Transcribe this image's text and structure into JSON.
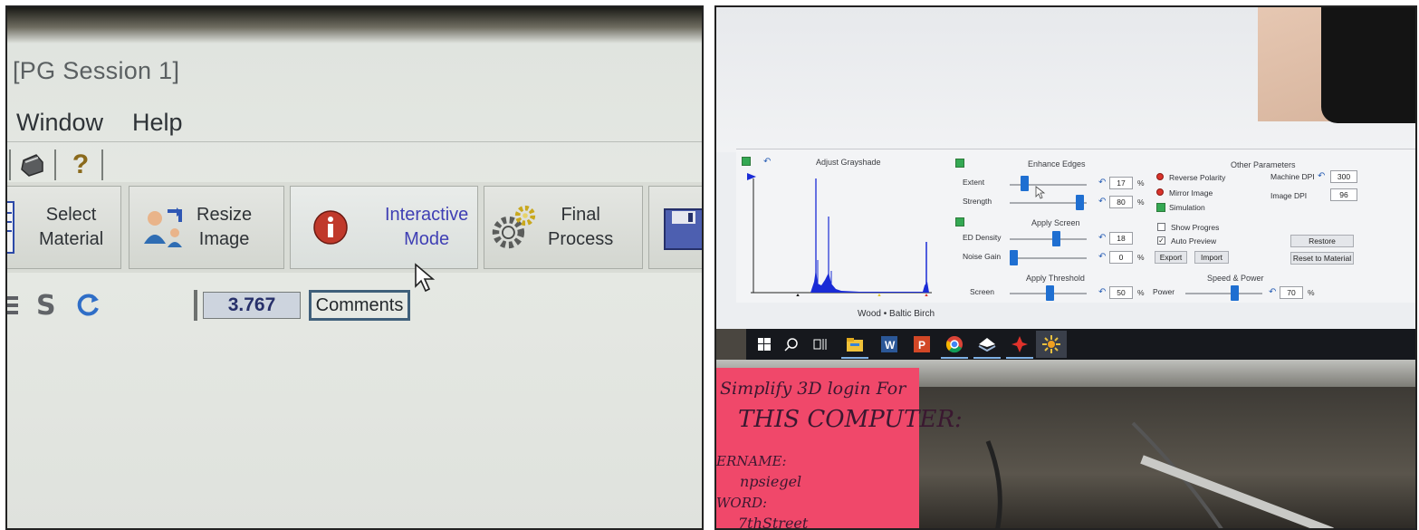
{
  "left": {
    "window_title": "[PG Session 1]",
    "menu": [
      "Window",
      "Help"
    ],
    "toolbar_icons": [
      "printer-icon",
      "help-question-icon"
    ],
    "help_glyph": "?",
    "buttons": [
      {
        "label_line1": "Select",
        "label_line2": "Material",
        "icon": "material-list-icon"
      },
      {
        "label_line1": "Resize",
        "label_line2": "Image",
        "icon": "resize-people-icon"
      },
      {
        "label_line1": "Interactive",
        "label_line2": "Mode",
        "icon": "info-icon",
        "active": true
      },
      {
        "label_line1": "Final",
        "label_line2": "Process",
        "icon": "gears-icon"
      },
      {
        "icon": "floppy-save-icon"
      }
    ],
    "status_value": "3.767",
    "comments_label": "Comments",
    "strip_icon_glyph": "S"
  },
  "right": {
    "grayshade": {
      "title": "Adjust Grayshade",
      "material_name": "Wood",
      "material_sep": "•",
      "material_type": "Baltic Birch"
    },
    "enhance_edges": {
      "title": "Enhance Edges",
      "extent_label": "Extent",
      "extent_value": "17",
      "extent_level": 0.17,
      "strength_label": "Strength",
      "strength_value": "80",
      "strength_level": 0.8,
      "unit": "%"
    },
    "apply_screen": {
      "title": "Apply Screen",
      "ed_density_label": "ED Density",
      "ed_density_value": "18",
      "ed_density_level": 0.5,
      "noise_gain_label": "Noise Gain",
      "noise_gain_value": "0",
      "noise_gain_level": 0.0,
      "unit": "%"
    },
    "apply_threshold": {
      "title": "Apply Threshold",
      "screen_label": "Screen",
      "screen_value": "50",
      "screen_level": 0.5,
      "unit": "%"
    },
    "other": {
      "title": "Other Parameters",
      "reverse_polarity": "Reverse Polarity",
      "mirror_image": "Mirror Image",
      "simulation": "Simulation",
      "show_progress": "Show Progres",
      "auto_preview": "Auto Preview",
      "export": "Export",
      "import": "Import",
      "machine_dpi_label": "Machine DPI",
      "machine_dpi_value": "300",
      "image_dpi_label": "Image DPI",
      "image_dpi_value": "96",
      "restore": "Restore",
      "reset_to_material": "Reset to Material"
    },
    "speed_power": {
      "title": "Speed & Power",
      "power_label": "Power",
      "power_value": "70",
      "power_level": 0.7,
      "unit": "%"
    },
    "taskbar_icons": [
      "windows-start-icon",
      "search-icon",
      "task-view-icon",
      "file-explorer-icon",
      "word-icon",
      "powerpoint-icon",
      "chrome-icon",
      "app-icon-1",
      "app-icon-2",
      "app-icon-3"
    ],
    "sticky_note": [
      "Simplify 3D login For",
      "THIS COMPUTER:",
      "ERNAME:",
      "npsiegel",
      "WORD:",
      "7thStreet"
    ],
    "colors": {
      "slider": "#1f6fd1",
      "note": "#f0486a",
      "histogram": "#1a2bd6"
    }
  }
}
